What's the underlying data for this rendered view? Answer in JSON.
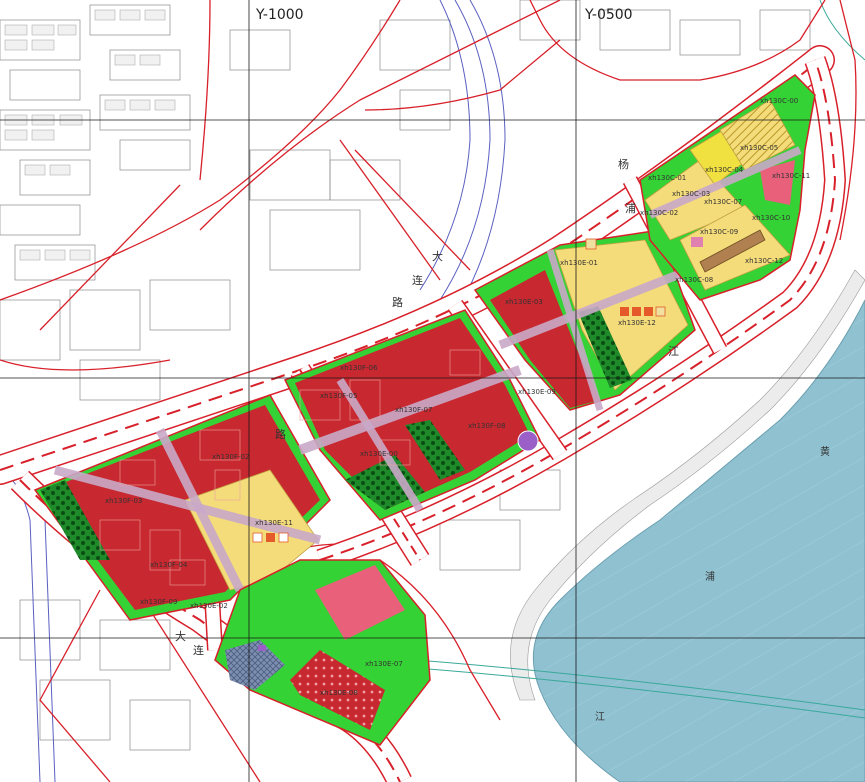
{
  "grid_labels": {
    "left": "Y-1000",
    "right": "Y-0500"
  },
  "parcel_labels": [
    "xh130C-00",
    "xh130C-05",
    "xh130C-04",
    "xh130C-01",
    "xh130C-11",
    "xh130C-03",
    "xh130C-02",
    "xh130C-07",
    "xh130C-10",
    "xh130C-09",
    "xh130C-12",
    "xh130C-08",
    "xh130E-12",
    "xh130E-03",
    "xh130E-01",
    "xh130E-09",
    "xh130F-06",
    "xh130F-07",
    "xh130F-05",
    "xh130F-08",
    "xh130E-00",
    "xh130E-11",
    "xh130F-03",
    "xh130F-02",
    "xh130F-04",
    "xh130E-02",
    "xh130F-09",
    "xh130E-07",
    "xh130E-08"
  ],
  "road_chars": [
    "大",
    "连",
    "路",
    "大",
    "连",
    "路",
    "杨",
    "浦",
    "江"
  ],
  "water_chars": [
    "黄",
    "浦",
    "江"
  ],
  "colors": {
    "commercial": "#c8282f",
    "residential": "#f5dc7a",
    "mixed": "#e8607a",
    "green": "#35d235",
    "water": "#8fc1d1",
    "road_red": "#d8202a"
  }
}
